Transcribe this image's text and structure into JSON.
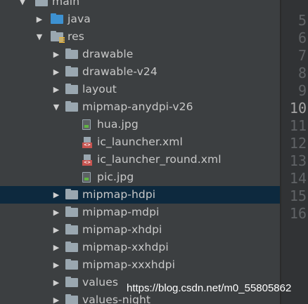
{
  "tree": [
    {
      "label": "main",
      "indent": 0,
      "arrow": "down",
      "icon": "folder",
      "selected": false
    },
    {
      "label": "java",
      "indent": 1,
      "arrow": "right",
      "icon": "folder-blue",
      "selected": false
    },
    {
      "label": "res",
      "indent": 1,
      "arrow": "down",
      "icon": "res-folder",
      "selected": false
    },
    {
      "label": "drawable",
      "indent": 2,
      "arrow": "right",
      "icon": "folder",
      "selected": false
    },
    {
      "label": "drawable-v24",
      "indent": 2,
      "arrow": "right",
      "icon": "folder",
      "selected": false
    },
    {
      "label": "layout",
      "indent": 2,
      "arrow": "right",
      "icon": "folder",
      "selected": false
    },
    {
      "label": "mipmap-anydpi-v26",
      "indent": 2,
      "arrow": "down",
      "icon": "folder",
      "selected": false
    },
    {
      "label": "hua.jpg",
      "indent": 3,
      "arrow": "none",
      "icon": "image-file",
      "selected": false
    },
    {
      "label": "ic_launcher.xml",
      "indent": 3,
      "arrow": "none",
      "icon": "xml-file",
      "selected": false
    },
    {
      "label": "ic_launcher_round.xml",
      "indent": 3,
      "arrow": "none",
      "icon": "xml-file",
      "selected": false
    },
    {
      "label": "pic.jpg",
      "indent": 3,
      "arrow": "none",
      "icon": "image-file",
      "selected": false
    },
    {
      "label": "mipmap-hdpi",
      "indent": 2,
      "arrow": "right",
      "icon": "folder",
      "selected": true
    },
    {
      "label": "mipmap-mdpi",
      "indent": 2,
      "arrow": "right",
      "icon": "folder",
      "selected": false
    },
    {
      "label": "mipmap-xhdpi",
      "indent": 2,
      "arrow": "right",
      "icon": "folder",
      "selected": false
    },
    {
      "label": "mipmap-xxhdpi",
      "indent": 2,
      "arrow": "right",
      "icon": "folder",
      "selected": false
    },
    {
      "label": "mipmap-xxxhdpi",
      "indent": 2,
      "arrow": "right",
      "icon": "folder",
      "selected": false
    },
    {
      "label": "values",
      "indent": 2,
      "arrow": "right",
      "icon": "folder",
      "selected": false
    },
    {
      "label": "values-night",
      "indent": 2,
      "arrow": "right",
      "icon": "folder",
      "selected": false
    }
  ],
  "gutter": {
    "line_numbers": [
      "5",
      "6",
      "7",
      "8",
      "9",
      "10",
      "11",
      "12",
      "13",
      "14",
      "15",
      "16"
    ],
    "current_line": "10"
  },
  "watermark": "https://blog.csdn.net/m0_55805862",
  "colors": {
    "background": "#3c3f41",
    "selected_row": "#0d293e",
    "gutter": "#313335",
    "folder": "#9aa7b0",
    "source_folder": "#3d91d1",
    "xml_badge": "#c75450"
  }
}
